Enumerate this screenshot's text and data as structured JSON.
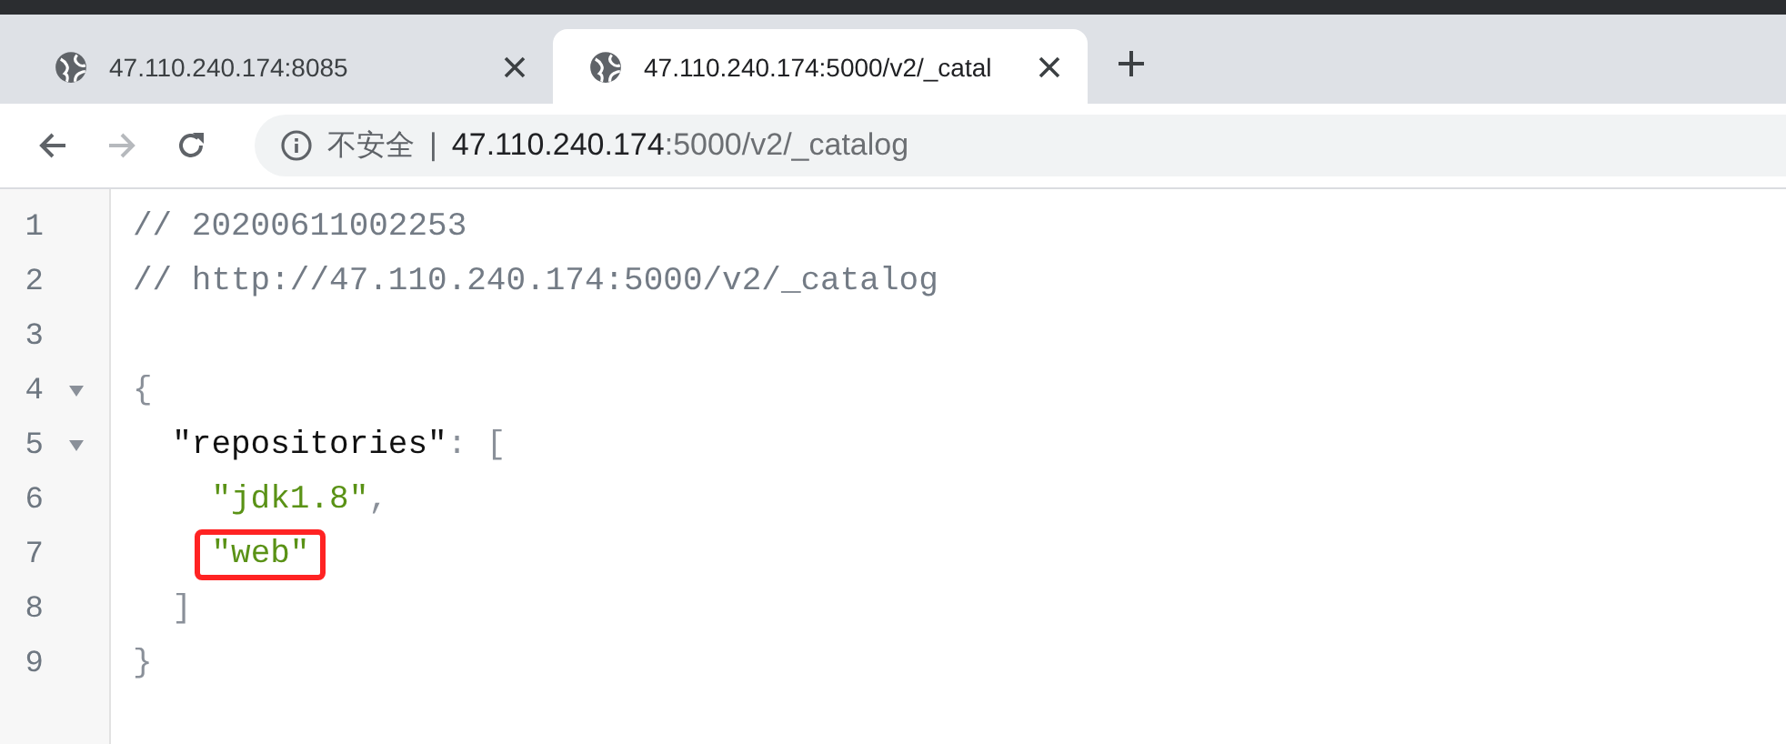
{
  "tabs": [
    {
      "title": "47.110.240.174:8085",
      "selected": false
    },
    {
      "title": "47.110.240.174:5000/v2/_catal",
      "selected": true
    }
  ],
  "toolbar": {
    "back_disabled": false,
    "forward_disabled": true
  },
  "address_bar": {
    "security": "不安全",
    "separator": "|",
    "host": "47.110.240.174",
    "path": ":5000/v2/_catalog"
  },
  "code_lines": [
    {
      "number": "1",
      "fold": false,
      "tokens": [
        {
          "kind": "comment",
          "text": "// 20200611002253"
        }
      ]
    },
    {
      "number": "2",
      "fold": false,
      "tokens": [
        {
          "kind": "comment",
          "text": "// http://47.110.240.174:5000/v2/_catalog"
        }
      ]
    },
    {
      "number": "3",
      "fold": false
    },
    {
      "number": "4",
      "fold": true,
      "tokens": [
        {
          "kind": "punct",
          "text": "{"
        }
      ]
    },
    {
      "number": "5",
      "fold": true,
      "tokens": [
        {
          "kind": "key",
          "text": "  \"repositories\""
        },
        {
          "kind": "punct",
          "text": ": ["
        }
      ]
    },
    {
      "number": "6",
      "fold": false,
      "tokens": [
        {
          "kind": "string",
          "text": "    \"jdk1.8\""
        },
        {
          "kind": "punct",
          "text": ","
        }
      ]
    },
    {
      "number": "7",
      "fold": false,
      "highlighted": true,
      "tokens": [
        {
          "kind": "string",
          "text": "    \"web\""
        }
      ]
    },
    {
      "number": "8",
      "fold": false,
      "tokens": [
        {
          "kind": "punct",
          "text": "  ]"
        }
      ]
    },
    {
      "number": "9",
      "fold": false,
      "tokens": [
        {
          "kind": "punct",
          "text": "}"
        }
      ]
    }
  ]
}
